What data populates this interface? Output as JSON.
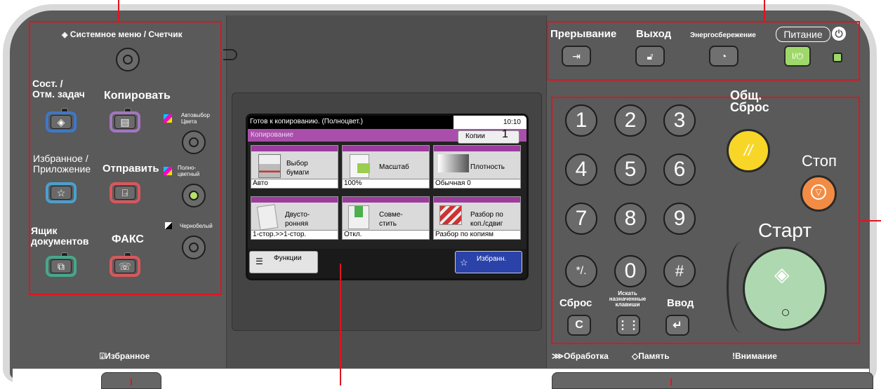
{
  "colors": {
    "callout": "#e0141e",
    "panel": "#5a5a5a",
    "bezel": "#d9d9d9",
    "lcd_mode_bar": "#a94fab"
  },
  "left_panel": {
    "system_menu": "Системное меню / Счетчик",
    "job_status": "Сост. /\nОтм. задач",
    "copy": "Копировать",
    "auto_color": "Автовыбор\nЦвета",
    "favorites_app": "Избранное /\nПриложение",
    "send": "Отправить",
    "full_color": "Полно-\nцветный",
    "doc_box": "Ящик\nдокументов",
    "fax": "ФАКС",
    "bw": "Чернобелый",
    "favorites_bottom": "Избранное"
  },
  "screen": {
    "status": "Готов к копированию. (Полноцвет.)",
    "time": "10:10",
    "mode": "Копирование",
    "copies_label": "Копии",
    "copies_value": "1",
    "tiles": [
      {
        "name": "Выбор\nбумаги",
        "value": "Авто"
      },
      {
        "name": "Масштаб",
        "value": "100%"
      },
      {
        "name": "Плотность",
        "value": "Обычная 0"
      },
      {
        "name": "Двусто-\nронняя",
        "value": "1-стор.>>1-стор."
      },
      {
        "name": "Совме-\nстить",
        "value": "Откл."
      },
      {
        "name": "Разбор по\nкоп./сдвиг",
        "value": "Разбор по копиям"
      }
    ],
    "functions_label": "Функции",
    "favorites_label": "Избранн."
  },
  "top_right": {
    "interrupt": "Прерывание",
    "logout": "Выход",
    "energy": "Энергосбережение",
    "power": "Питание",
    "power_key": "I/⏻"
  },
  "keypad": {
    "keys": [
      "1",
      "2",
      "3",
      "4",
      "5",
      "6",
      "7",
      "8",
      "9",
      "*/.",
      "0",
      "#"
    ],
    "reset_all": "Общ.\nСброс",
    "stop": "Стоп",
    "start": "Старт",
    "clear": "Сброс",
    "clear_key": "C",
    "search": "Искать\nназначенные\nклавиши",
    "enter": "Ввод",
    "processing": "Обработка",
    "memory": "Память",
    "attention": "Внимание"
  }
}
